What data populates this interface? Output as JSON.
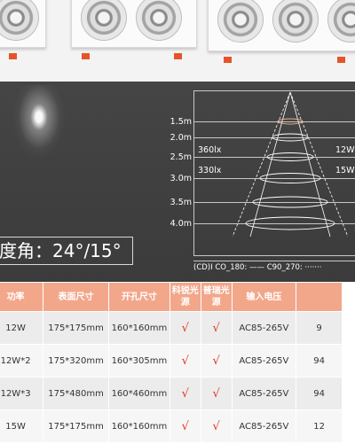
{
  "banner": {
    "beam_angle": "度角：24°/15°",
    "levels": [
      "1.5m",
      "2.0m",
      "2.5m",
      "3.0m",
      "3.5m",
      "4.0m"
    ],
    "lux_left": [
      "360lx",
      "330lx"
    ],
    "lux_right": [
      "12W",
      "15W"
    ],
    "legend": "(CD)I   CO_180: ——   C90_270: ·······"
  },
  "table": {
    "headers": [
      "功率",
      "表面尺寸",
      "开孔尺寸",
      "科锐光源",
      "普瑞光源",
      "输入电压",
      ""
    ],
    "rows": [
      [
        "12W",
        "175*175mm",
        "160*160mm",
        "√",
        "√",
        "AC85-265V",
        "9"
      ],
      [
        "12W*2",
        "175*320mm",
        "160*305mm",
        "√",
        "√",
        "AC85-265V",
        "94"
      ],
      [
        "12W*3",
        "175*480mm",
        "160*460mm",
        "√",
        "√",
        "AC85-265V",
        "94"
      ],
      [
        "15W",
        "175*175mm",
        "160*160mm",
        "√",
        "√",
        "AC85-265V",
        "12"
      ]
    ]
  }
}
